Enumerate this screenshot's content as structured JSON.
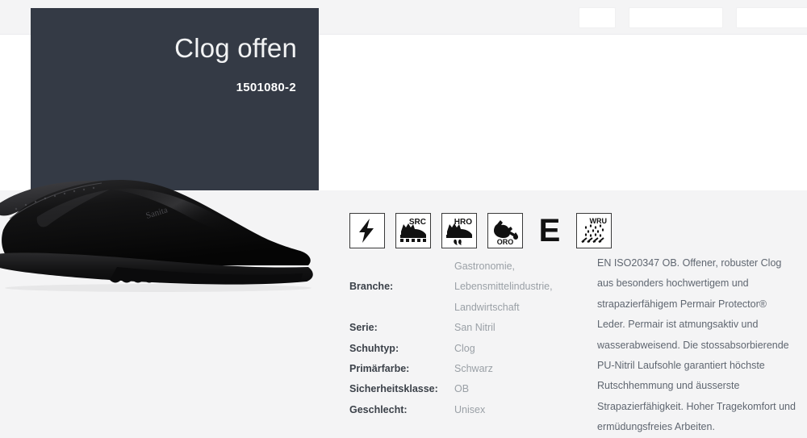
{
  "toolbar": {
    "fields": [
      {
        "name": "toolbar-field-1",
        "value": ""
      },
      {
        "name": "toolbar-field-2",
        "value": ""
      },
      {
        "name": "toolbar-field-3",
        "value": ""
      }
    ]
  },
  "hero": {
    "title": "Clog offen",
    "sku": "1501080-2",
    "background_color": "#343a45",
    "image_alt": "Schwarzer Sanita Clog, Seitenansicht"
  },
  "pictograms": [
    {
      "id": "antistatic",
      "icon": "lightning-bolt-icon",
      "label": ""
    },
    {
      "id": "src",
      "icon": "slip-resistant-icon",
      "label": "SRC"
    },
    {
      "id": "hro",
      "icon": "heat-resistant-outsole-icon",
      "label": "HRO"
    },
    {
      "id": "oro",
      "icon": "oil-resistant-outsole-icon",
      "label": "ORO"
    },
    {
      "id": "energy-absorption",
      "icon": "letter-e-icon",
      "label": "E"
    },
    {
      "id": "wru",
      "icon": "water-resistant-upper-icon",
      "label": "WRU"
    }
  ],
  "specs": [
    {
      "label": "Branche:",
      "values": [
        "Gastronomie,",
        "Lebensmittelindustrie,",
        "Landwirtschaft"
      ]
    },
    {
      "label": "Serie:",
      "values": [
        "San Nitril"
      ]
    },
    {
      "label": "Schuhtyp:",
      "values": [
        "Clog"
      ]
    },
    {
      "label": "Primärfarbe:",
      "values": [
        "Schwarz"
      ]
    },
    {
      "label": "Sicherheitsklasse:",
      "values": [
        "OB"
      ]
    },
    {
      "label": "Geschlecht:",
      "values": [
        "Unisex"
      ]
    }
  ],
  "description": {
    "text": "EN ISO20347 OB. Offener, robuster Clog aus besonders hochwertigem und strapazierfähigem Permair Protector® Leder. Permair ist atmungsaktiv und wasserabweisend. Die stossabsorbierende PU-Nitril Laufsohle garantiert höchste Rutschhemmung und äusserste Strapazierfähigkeit. Hoher Tragekomfort und ermüdungsfreies Arbeiten."
  },
  "colors": {
    "page_background": "#f4f4f5",
    "sheet": "#ffffff",
    "hero": "#343a45",
    "label_text": "#3b4149",
    "value_text": "#9aa0a6",
    "body_text": "#5f6670"
  }
}
